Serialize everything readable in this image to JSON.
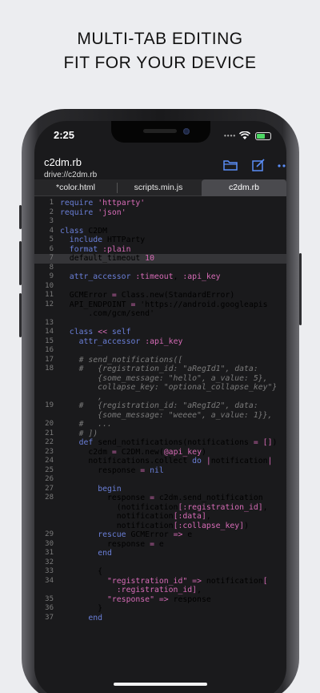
{
  "promo": {
    "line1": "MULTI-TAB EDITING",
    "line2": "FIT FOR YOUR DEVICE"
  },
  "status_bar": {
    "time": "2:25"
  },
  "header": {
    "file_name": "c2dm.rb",
    "file_path": "drive://c2dm.rb",
    "icons": [
      "folder-icon",
      "edit-icon",
      "more-icon"
    ]
  },
  "tabs": [
    {
      "label": "*color.html",
      "active": false
    },
    {
      "label": "scripts.min.js",
      "active": false
    },
    {
      "label": "c2dm.rb",
      "active": true
    }
  ],
  "colors": {
    "accent": "#5b8ef7",
    "string": "#d66bb6",
    "keyword": "#6a7fd8",
    "background": "#1a1a1c"
  },
  "editor": {
    "line_numbers": [
      "1",
      "2",
      "3",
      "4",
      "5",
      "6",
      "7",
      "8",
      "9",
      "10",
      "11",
      "12",
      "",
      "13",
      "14",
      "15",
      "16",
      "17",
      "18",
      "",
      "",
      "",
      "19",
      "",
      "20",
      "21",
      "22",
      "23",
      "24",
      "25",
      "26",
      "27",
      "28",
      "",
      "",
      "",
      "29",
      "30",
      "31",
      "32",
      "33",
      "34",
      "",
      "35",
      "36",
      "37"
    ],
    "lines": [
      "require 'httparty'",
      "require 'json'",
      "",
      "class C2DM",
      "  include HTTParty",
      "  format :plain",
      "  default_timeout 10",
      "",
      "  attr_accessor :timeout, :api_key",
      "",
      "  GCMError = Class.new(StandardError)",
      "  API_ENDPOINT = 'https://android.googleapis",
      "      .com/gcm/send'",
      "",
      "  class << self",
      "    attr_accessor :api_key",
      "",
      "    # send_notifications([",
      "    #   {registration_id: \"aRegId1\", data:",
      "        {some_message: \"hello\", a_value: 5},",
      "        collapse_key: \"optional_collapse_key\"}",
      "        ,",
      "    #   {registration_id: \"aRegId2\", data:",
      "        {some_message: \"weeee\", a_value: 1}},",
      "    #   ...",
      "    # ])",
      "    def send_notifications(notifications = [])",
      "      c2dm = C2DM.new(@api_key)",
      "      notifications.collect do |notification|",
      "        response = nil",
      "",
      "        begin",
      "          response = c2dm.send_notification",
      "            (notification[:registration_id],",
      "            notification[:data],",
      "            notification[:collapse_key])",
      "        rescue GCMError => e",
      "          response = e",
      "        end",
      "",
      "        {",
      "          \"registration_id\" => notification[",
      "            :registration_id],",
      "          \"response\" => response",
      "        }",
      "      end"
    ]
  }
}
